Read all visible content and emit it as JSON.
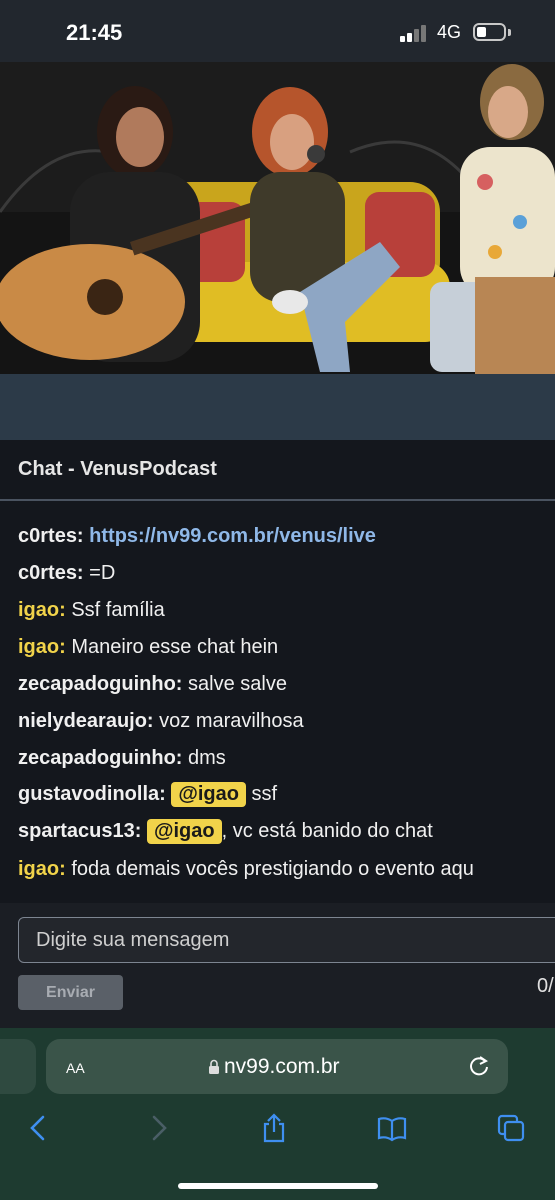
{
  "status_bar": {
    "time": "21:45",
    "network": "4G"
  },
  "chat": {
    "title": "Chat - VenusPodcast",
    "messages": [
      {
        "user": "c0rtes:",
        "user_color": "#ffffff",
        "link": "https://nv99.com.br/venus/live"
      },
      {
        "user": "c0rtes:",
        "user_color": "#ffffff",
        "text": "=D"
      },
      {
        "user": "igao:",
        "user_color": "#f1d34a",
        "text": "Ssf família"
      },
      {
        "user": "igao:",
        "user_color": "#f1d34a",
        "text": "Maneiro esse chat hein"
      },
      {
        "user": "zecapadoguinho:",
        "user_color": "#ffffff",
        "text": "salve salve"
      },
      {
        "user": "nielydearaujo:",
        "user_color": "#ffffff",
        "text": "voz maravilhosa"
      },
      {
        "user": "zecapadoguinho:",
        "user_color": "#ffffff",
        "text": "dms"
      },
      {
        "user": "gustavodinolla:",
        "user_color": "#ffffff",
        "mention": "@igao",
        "text": "ssf"
      },
      {
        "user": "spartacus13:",
        "user_color": "#ffffff",
        "mention": "@igao",
        "text": ", vc está banido do chat"
      },
      {
        "user": "igao:",
        "user_color": "#f1d34a",
        "text": "foda demais vocês prestigiando o evento aqu"
      }
    ],
    "input_placeholder": "Digite sua mensagem",
    "send_label": "Enviar",
    "counter": "0/"
  },
  "browser": {
    "aa_label": "AA",
    "url": "nv99.com.br",
    "toolbar": [
      "back-icon",
      "forward-icon",
      "share-icon",
      "bookmarks-icon",
      "tabs-icon"
    ]
  },
  "colors": {
    "accent_yellow": "#f1d34a",
    "link_blue": "#8fb8e8",
    "browser_green": "#1e3b30"
  }
}
